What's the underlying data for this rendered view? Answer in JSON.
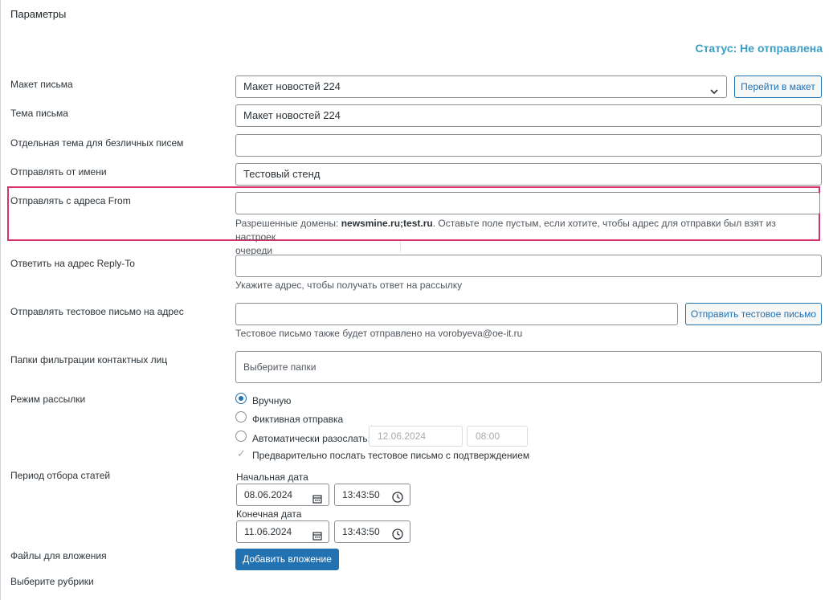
{
  "header": {
    "title": "Параметры",
    "status": "Статус: Не отправлена"
  },
  "fields": {
    "layout": {
      "label": "Макет письма",
      "value": "Макет новостей 224",
      "button": "Перейти в макет"
    },
    "subject": {
      "label": "Тема письма",
      "value": "Макет новостей 224"
    },
    "impersonal_subject": {
      "label": "Отдельная тема для безличных писем",
      "value": ""
    },
    "from_name": {
      "label": "Отправлять от имени",
      "value": "Тестовый стенд"
    },
    "from_address": {
      "label": "Отправлять с адреса From",
      "value": "",
      "help_prefix": "Разрешенные домены: ",
      "help_domains": "newsmine.ru;test.ru",
      "help_suffix": ". Оставьте поле пустым, если хотите, чтобы адрес для отправки был взят из настроек",
      "help_line2": "очереди"
    },
    "reply_to": {
      "label": "Ответить на адрес Reply-To",
      "value": "",
      "help": "Укажите адрес, чтобы получать ответ на рассылку"
    },
    "test_email": {
      "label": "Отправлять тестовое письмо на адрес",
      "value": "",
      "button": "Отправить тестовое письмо",
      "help": "Тестовое письмо также будет отправлено на vorobyeva@oe-it.ru"
    },
    "folders": {
      "label": "Папки фильтрации контактных лиц",
      "placeholder": "Выберите папки"
    }
  },
  "mode": {
    "label": "Режим рассылки",
    "options": [
      {
        "label": "Вручную",
        "checked": true
      },
      {
        "label": "Фиктивная отправка",
        "checked": false
      },
      {
        "label": "Автоматически разослать:",
        "checked": false
      }
    ],
    "auto_date": "12.06.2024",
    "auto_time": "08:00",
    "pre_test_label": "Предварительно послать тестовое письмо с подтверждением",
    "pre_test_checked": true
  },
  "period": {
    "label": "Период отбора статей",
    "start_label": "Начальная дата",
    "start_date": "08.06.2024",
    "start_time": "13:43:50",
    "end_label": "Конечная дата",
    "end_date": "11.06.2024",
    "end_time": "13:43:50"
  },
  "attachments": {
    "label": "Файлы для вложения",
    "button": "Добавить вложение"
  },
  "rubrics": {
    "label": "Выберите рубрики"
  },
  "icons": {
    "select": "chevron-down-icon",
    "date": "calendar-icon",
    "time": "clock-icon"
  },
  "colors": {
    "accent": "#2271b1",
    "status": "#3c9ec6",
    "highlight": "#d6336c"
  }
}
